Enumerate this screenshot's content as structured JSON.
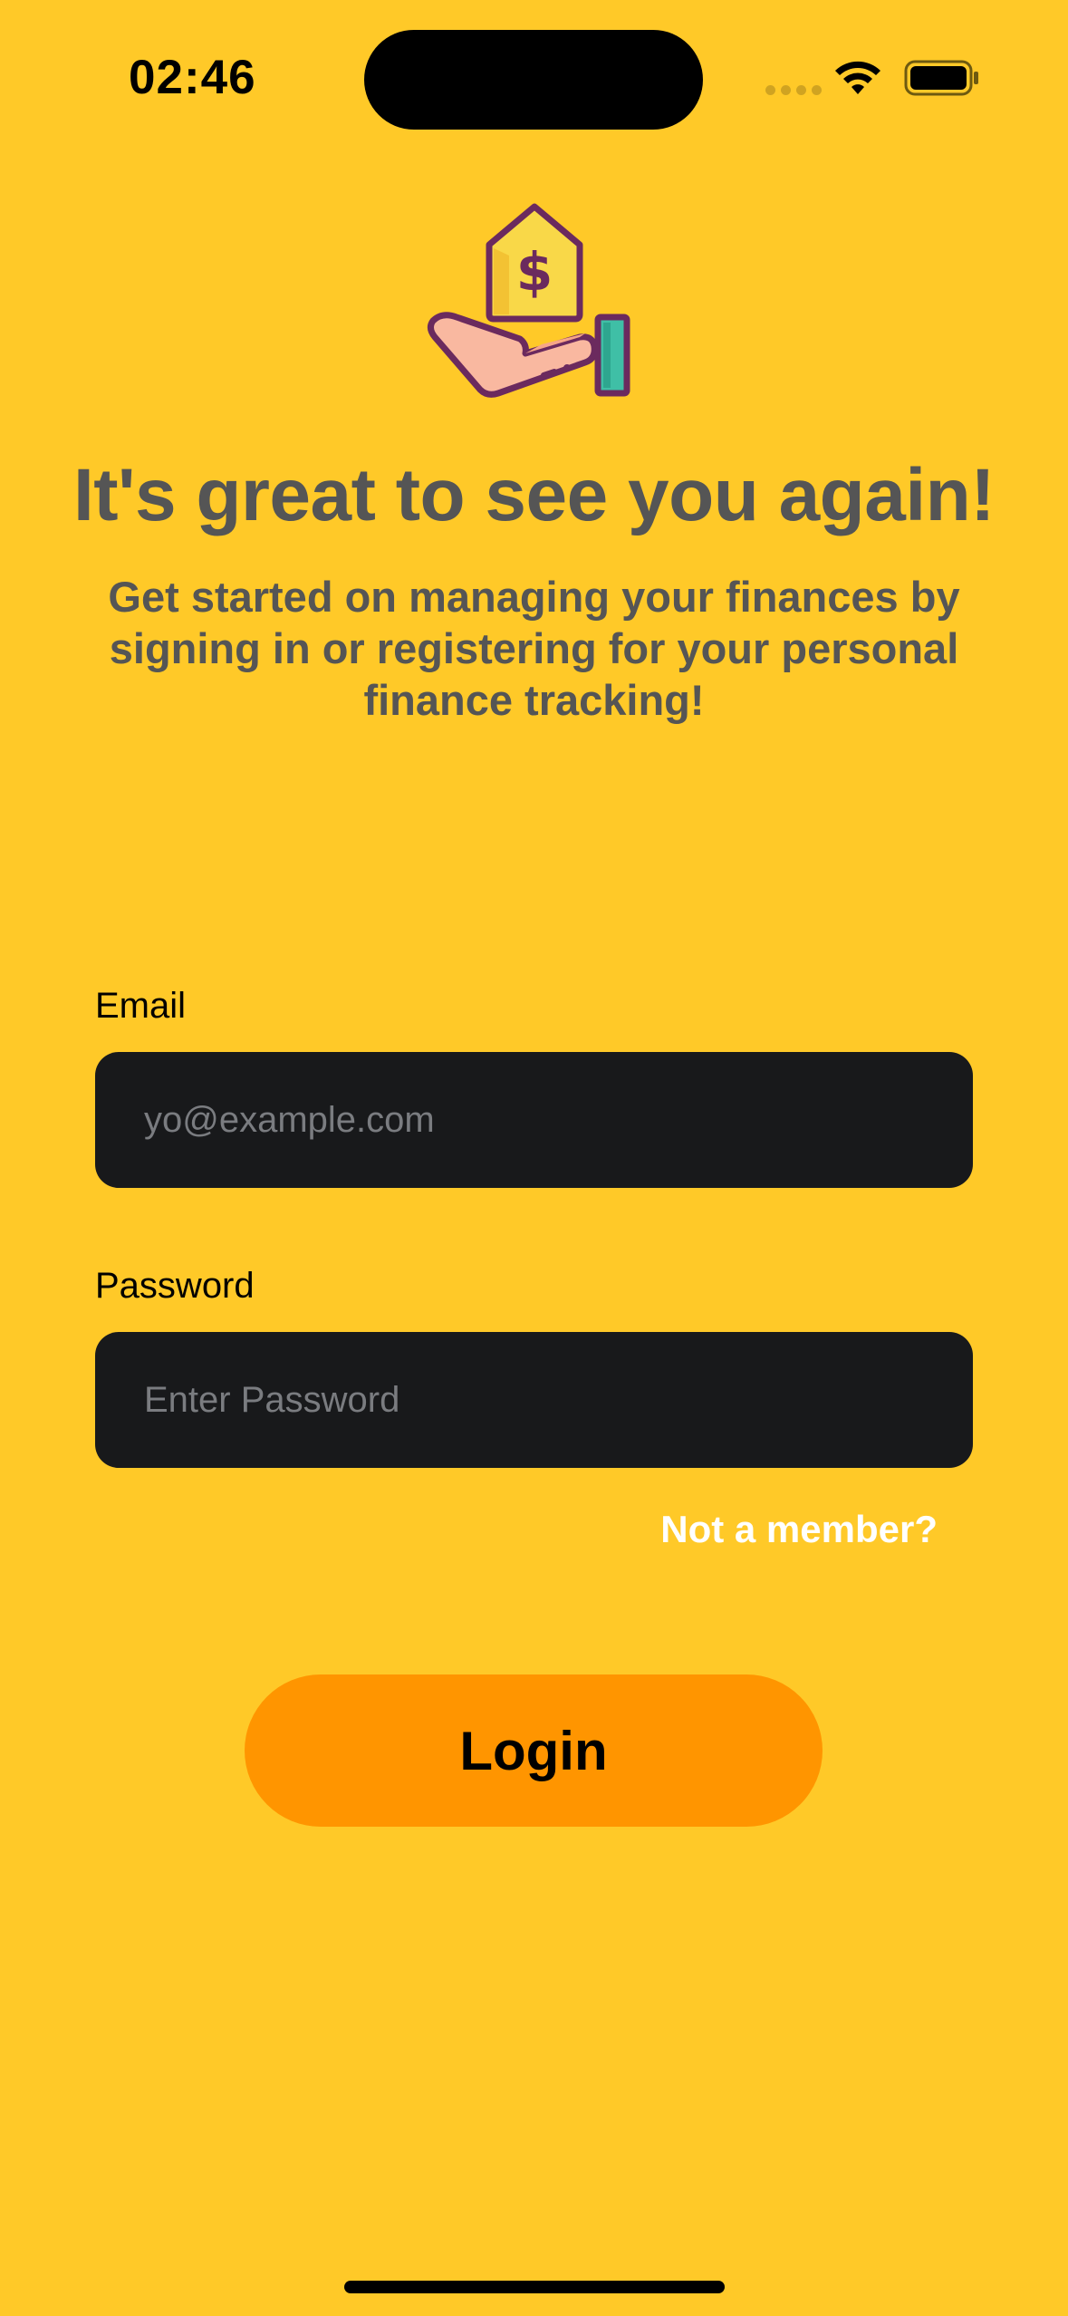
{
  "status_bar": {
    "time": "02:46"
  },
  "hero": {
    "icon": "hand-holding-money-tag-icon",
    "title": "It's great to see you again!",
    "subtitle": "Get started on managing your finances by signing in or registering for your personal finance tracking!"
  },
  "form": {
    "email_label": "Email",
    "email_placeholder": "yo@example.com",
    "email_value": "",
    "password_label": "Password",
    "password_placeholder": "Enter Password",
    "password_value": "",
    "signup_link": "Not a member?",
    "login_label": "Login"
  },
  "colors": {
    "background": "#FFC928",
    "input_background": "#18191B",
    "button": "#FF9500",
    "heading_text": "#555555"
  }
}
